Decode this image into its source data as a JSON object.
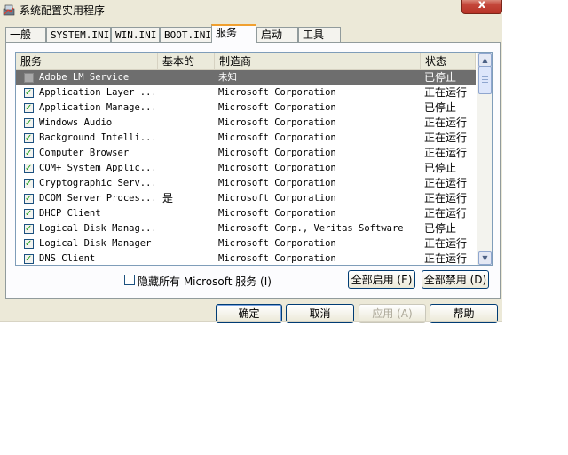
{
  "window": {
    "title": "系统配置实用程序",
    "close_label": "x"
  },
  "tabs": [
    {
      "label": "一般"
    },
    {
      "label": "SYSTEM.INI"
    },
    {
      "label": "WIN.INI"
    },
    {
      "label": "BOOT.INI"
    },
    {
      "label": "服务"
    },
    {
      "label": "启动"
    },
    {
      "label": "工具"
    }
  ],
  "active_tab": "服务",
  "table": {
    "headers": {
      "service": "服务",
      "basic": "基本的",
      "manufacturer": "制造商",
      "status": "状态"
    },
    "rows": [
      {
        "name": "Adobe LM Service",
        "basic": "",
        "manufacturer": "未知",
        "status": "已停止",
        "checked": false,
        "selected": true
      },
      {
        "name": "Application Layer ...",
        "basic": "",
        "manufacturer": "Microsoft Corporation",
        "status": "正在运行",
        "checked": true
      },
      {
        "name": "Application Manage...",
        "basic": "",
        "manufacturer": "Microsoft Corporation",
        "status": "已停止",
        "checked": true
      },
      {
        "name": "Windows Audio",
        "basic": "",
        "manufacturer": "Microsoft Corporation",
        "status": "正在运行",
        "checked": true
      },
      {
        "name": "Background Intelli...",
        "basic": "",
        "manufacturer": "Microsoft Corporation",
        "status": "正在运行",
        "checked": true
      },
      {
        "name": "Computer Browser",
        "basic": "",
        "manufacturer": "Microsoft Corporation",
        "status": "正在运行",
        "checked": true
      },
      {
        "name": "COM+ System Applic...",
        "basic": "",
        "manufacturer": "Microsoft Corporation",
        "status": "已停止",
        "checked": true
      },
      {
        "name": "Cryptographic Serv...",
        "basic": "",
        "manufacturer": "Microsoft Corporation",
        "status": "正在运行",
        "checked": true
      },
      {
        "name": "DCOM Server Proces...",
        "basic": "是",
        "manufacturer": "Microsoft Corporation",
        "status": "正在运行",
        "checked": true
      },
      {
        "name": "DHCP Client",
        "basic": "",
        "manufacturer": "Microsoft Corporation",
        "status": "正在运行",
        "checked": true
      },
      {
        "name": "Logical Disk Manag...",
        "basic": "",
        "manufacturer": "Microsoft Corp., Veritas Software",
        "status": "已停止",
        "checked": true
      },
      {
        "name": "Logical Disk Manager",
        "basic": "",
        "manufacturer": "Microsoft Corporation",
        "status": "正在运行",
        "checked": true
      },
      {
        "name": "DNS Client",
        "basic": "",
        "manufacturer": "Microsoft Corporation",
        "status": "正在运行",
        "checked": true
      }
    ]
  },
  "hide_ms_label": "隐藏所有 Microsoft 服务 (I)",
  "buttons": {
    "enable_all": "全部启用 (E)",
    "disable_all": "全部禁用 (D)",
    "ok": "确定",
    "cancel": "取消",
    "apply": "应用 (A)",
    "help": "帮助"
  }
}
